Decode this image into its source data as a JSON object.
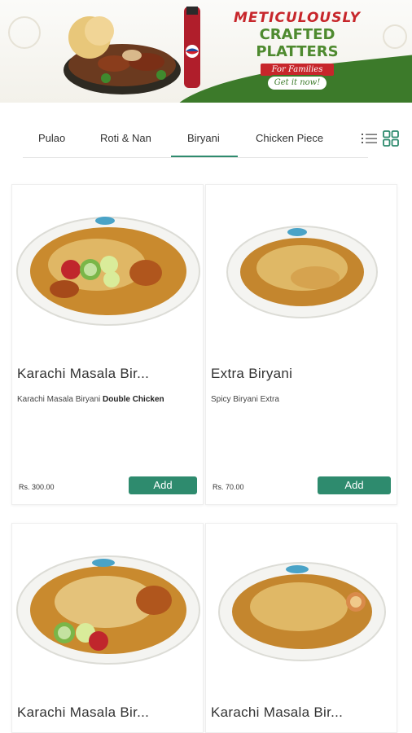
{
  "banner": {
    "headline_line1": "METICULOUSLY",
    "headline_line2": "CRAFTED PLATTERS",
    "tagline": "For Families",
    "cta": "Get it now!",
    "brand_colors": {
      "red": "#c7262b",
      "green": "#3c7a2a"
    }
  },
  "tabs": {
    "items": [
      "Pulao",
      "Roti & Nan",
      "Biryani",
      "Chicken Piece"
    ],
    "active": "Biryani",
    "accent": "#2e8b6e"
  },
  "view_toggle": {
    "list_icon": "list-icon",
    "grid_icon": "grid-icon",
    "selected": "grid"
  },
  "products": [
    {
      "title": "Karachi Masala Bir...",
      "desc_plain": "Karachi Masala Biryani ",
      "desc_bold": "Double Chicken",
      "price": "Rs. 300.00",
      "button": "Add"
    },
    {
      "title": "Extra Biryani",
      "desc_plain": "Spicy Biryani Extra",
      "desc_bold": "",
      "price": "Rs. 70.00",
      "button": "Add"
    },
    {
      "title": "Karachi Masala Bir..."
    },
    {
      "title": "Karachi Masala Bir..."
    }
  ]
}
